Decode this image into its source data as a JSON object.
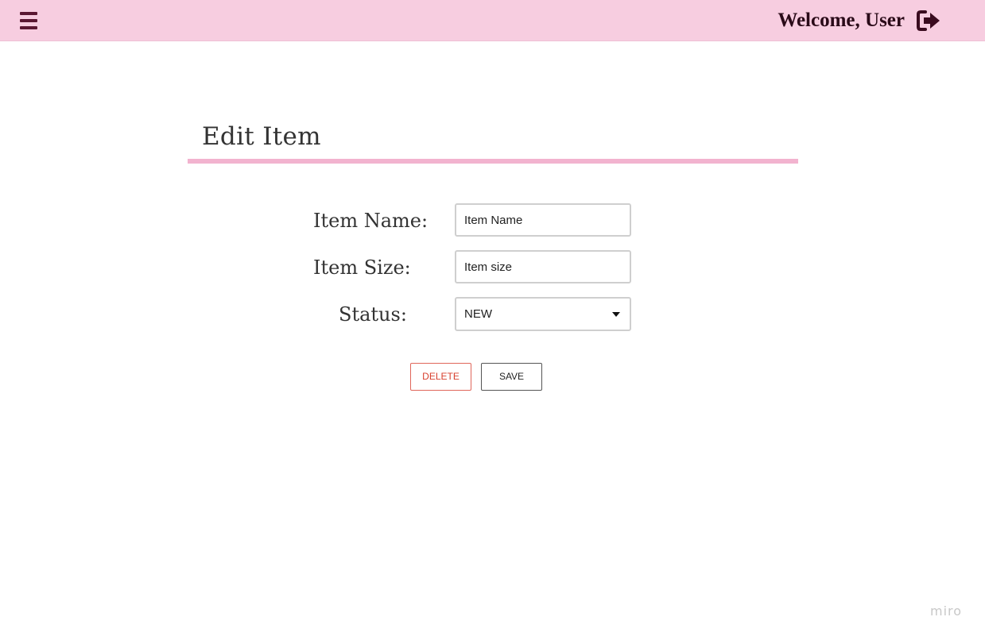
{
  "header": {
    "welcome_text": "Welcome, User",
    "menu_icon": "hamburger-menu-icon",
    "logout_icon": "sign-out-icon",
    "bar_color": "#f7cde0",
    "icon_color": "#5a1732"
  },
  "page": {
    "title": "Edit Item",
    "accent_color": "#f2b3cf"
  },
  "form": {
    "item_name_label": "Item Name:",
    "item_name_placeholder": "Item Name",
    "item_size_label": "Item Size:",
    "item_size_placeholder": "Item size",
    "status_label": "Status:",
    "status_value": "NEW"
  },
  "actions": {
    "delete_label": "DELETE",
    "save_label": "SAVE",
    "delete_color": "#d8412f"
  },
  "watermark": "miro"
}
